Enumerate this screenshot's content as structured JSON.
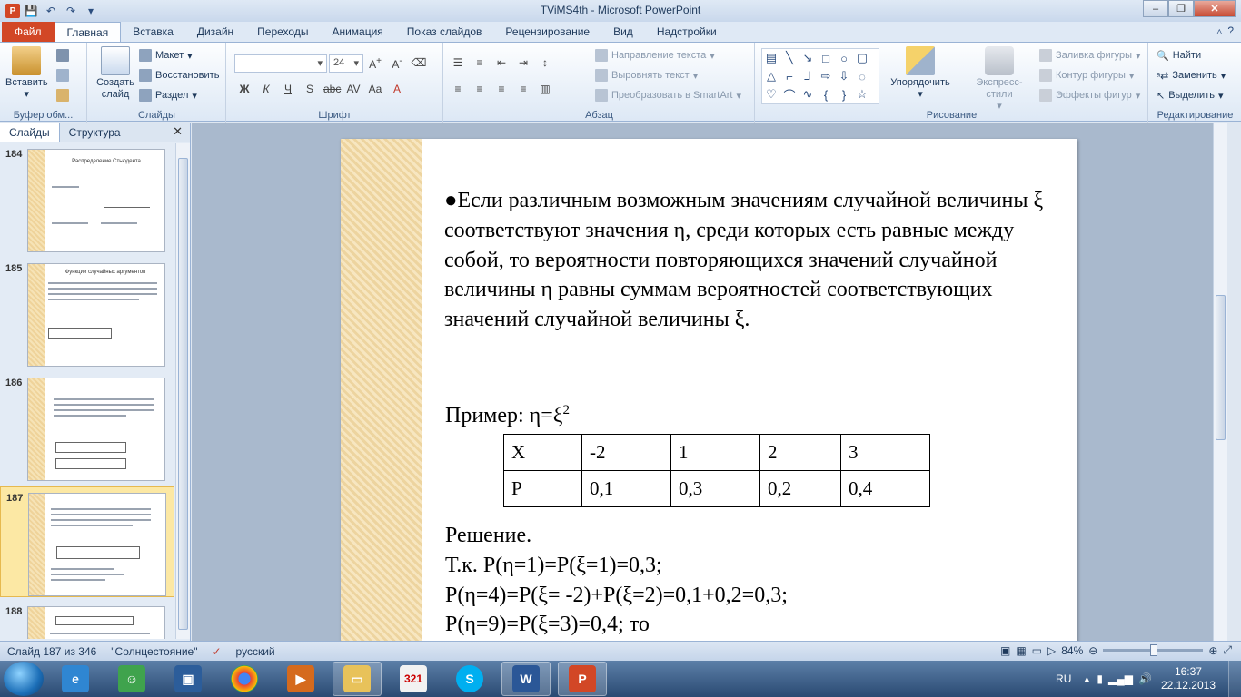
{
  "window": {
    "title": "TViMS4th - Microsoft PowerPoint"
  },
  "ribbon": {
    "tabs": [
      "Файл",
      "Главная",
      "Вставка",
      "Дизайн",
      "Переходы",
      "Анимация",
      "Показ слайдов",
      "Рецензирование",
      "Вид",
      "Надстройки"
    ],
    "active_tab": "Главная",
    "clipboard": {
      "paste": "Вставить",
      "label": "Буфер обм..."
    },
    "slides": {
      "create": "Создать слайд",
      "layout": "Макет",
      "reset": "Восстановить",
      "section": "Раздел",
      "label": "Слайды"
    },
    "font": {
      "name": "",
      "size": "24",
      "label": "Шрифт"
    },
    "paragraph": {
      "direction": "Направление текста",
      "align": "Выровнять текст",
      "smartart": "Преобразовать в SmartArt",
      "label": "Абзац"
    },
    "drawing": {
      "arrange": "Упорядочить",
      "quick_styles": "Экспресс-стили",
      "fill": "Заливка фигуры",
      "outline": "Контур фигуры",
      "effects": "Эффекты фигур",
      "label": "Рисование"
    },
    "editing": {
      "find": "Найти",
      "replace": "Заменить",
      "select": "Выделить",
      "label": "Редактирование"
    }
  },
  "left_pane": {
    "tabs": [
      "Слайды",
      "Структура"
    ],
    "slides": [
      {
        "number": "184",
        "title": "Распределение Стьюдента"
      },
      {
        "number": "185",
        "title": "Функции случайных аргументов"
      },
      {
        "number": "186",
        "title": ""
      },
      {
        "number": "187",
        "title": "",
        "selected": true
      },
      {
        "number": "188",
        "title": ""
      }
    ]
  },
  "slide": {
    "bullet_text": "●Если различным возможным значениям случайной величины ξ соответствуют значения η, среди которых есть равные между собой, то вероятности повторяющихся значений случайной величины η равны суммам вероятностей соответствующих значений случайной величины ξ.",
    "example": "Пример: η=ξ",
    "example_sup": "2",
    "table": {
      "rows": [
        [
          "X",
          "-2",
          "1",
          "2",
          "3"
        ],
        [
          "P",
          "0,1",
          "0,3",
          "0,2",
          "0,4"
        ]
      ]
    },
    "solution": [
      "Решение.",
      "Т.к. P(η=1)=P(ξ=1)=0,3;",
      "P(η=4)=P(ξ= -2)+P(ξ=2)=0,1+0,2=0,3;",
      "P(η=9)=P(ξ=3)=0,4; то"
    ]
  },
  "status_bar": {
    "slide_info": "Слайд 187 из 346",
    "theme": "\"Солнцестояние\"",
    "language": "русский",
    "zoom": "84%"
  },
  "taskbar": {
    "lang": "RU",
    "time": "16:37",
    "date": "22.12.2013"
  },
  "colors": {
    "file_tab": "#d24726",
    "ribbon_bg": "#dde8f5",
    "slide_strip": "#efd39a",
    "selected_thumb": "#fce8a4"
  }
}
